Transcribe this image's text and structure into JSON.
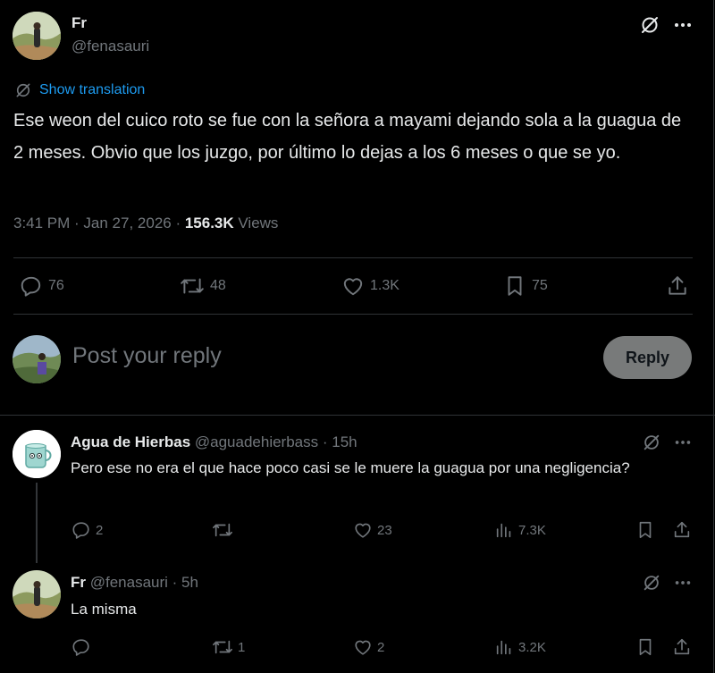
{
  "main_tweet": {
    "name": "Fr",
    "handle": "@fenasauri",
    "show_translation": "Show translation",
    "text": "Ese weon del cuico roto se fue con la señora a mayami dejando sola a la guagua de 2 meses. Obvio que los juzgo, por último lo dejas a los 6 meses o que se yo.",
    "time": "3:41 PM · Jan 27, 2026 · ",
    "views_count": "156.3K",
    "views_label": " Views",
    "stats": {
      "replies": "76",
      "retweets": "48",
      "likes": "1.3K",
      "bookmarks": "75"
    }
  },
  "reply_box": {
    "placeholder": "Post your reply",
    "button": "Reply"
  },
  "replies": [
    {
      "name": "Agua de Hierbas",
      "handle": "@aguadehierbass",
      "time": " · 15h",
      "text": "Pero ese no era el que hace poco casi se le muere la guagua por una negligencia?",
      "stats": {
        "replies": "2",
        "retweets": "",
        "likes": "23",
        "views": "7.3K"
      }
    },
    {
      "name": "Fr",
      "handle": "@fenasauri",
      "time": " · 5h",
      "text": "La misma",
      "stats": {
        "replies": "",
        "retweets": "1",
        "likes": "2",
        "views": "3.2K"
      }
    }
  ],
  "icons": [
    "grok-icon",
    "more-icon",
    "translate-icon",
    "reply-icon",
    "retweet-icon",
    "like-icon",
    "bookmark-icon",
    "share-icon",
    "views-icon"
  ],
  "colors": {
    "background": "#000000",
    "text": "#e7e9ea",
    "muted": "#71767b",
    "link": "#1d9bf0",
    "divider": "#2f3336",
    "reply_button": "#787a7a"
  }
}
